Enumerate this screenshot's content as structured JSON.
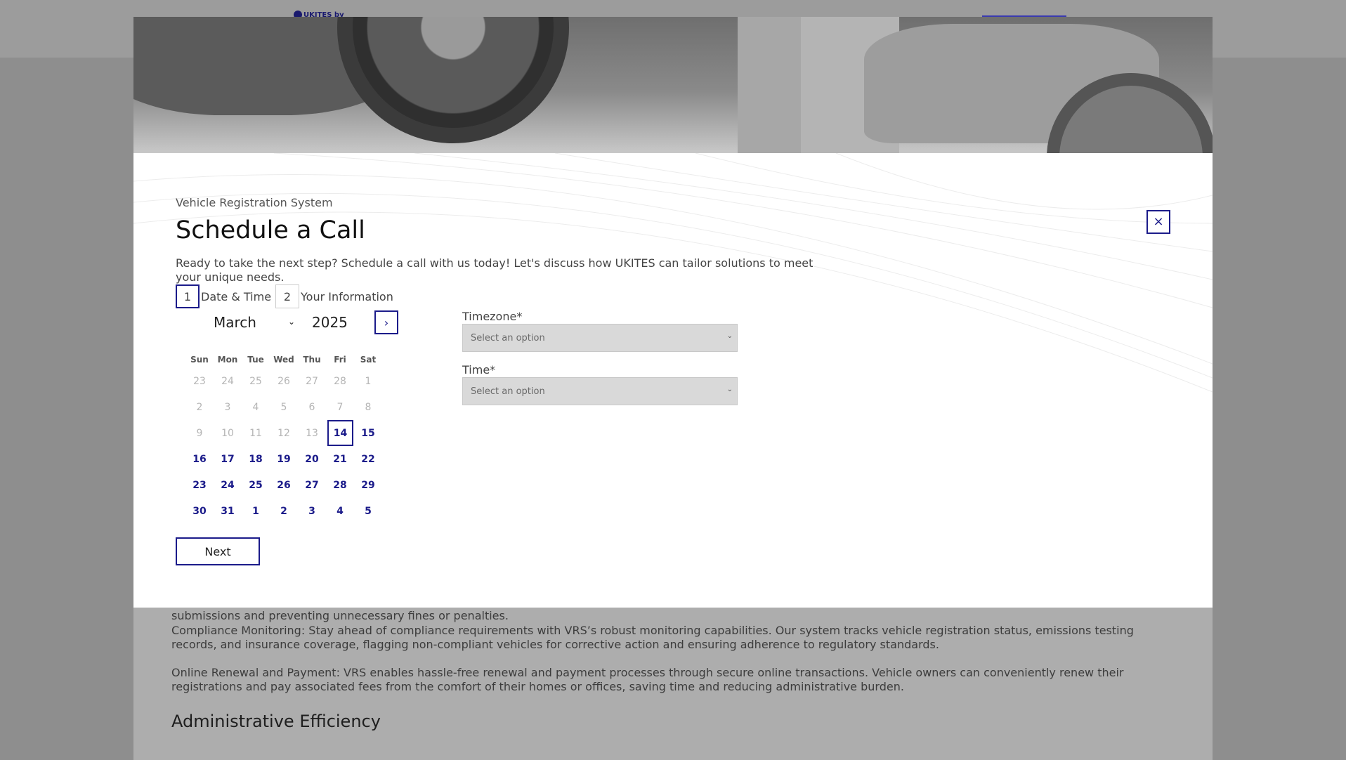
{
  "background": {
    "logo_text": "UKITES by",
    "paragraph1": "submissions and preventing unnecessary fines or penalties.",
    "paragraph2": "Compliance Monitoring: Stay ahead of compliance requirements with VRS’s robust monitoring capabilities. Our system tracks vehicle registration status, emissions testing records, and insurance coverage, flagging non-compliant vehicles for corrective action and ensuring adherence to regulatory standards.",
    "paragraph3": "Online Renewal and Payment: VRS  enables hassle-free renewal and payment processes through secure online transactions. Vehicle owners can conveniently renew their registrations and pay associated fees from the comfort of their homes or offices, saving time and reducing administrative burden.",
    "heading": "Administrative Efficiency"
  },
  "modal": {
    "eyebrow": "Vehicle Registration System",
    "title": "Schedule a Call",
    "description": "Ready to take the next step? Schedule a call with us today! Let's discuss how UKITES can tailor solutions to meet your unique needs.",
    "close_label": "×",
    "steps": [
      {
        "num": "1",
        "label": "Date & Time"
      },
      {
        "num": "2",
        "label": "Your Information"
      }
    ],
    "calendar": {
      "month": "March",
      "year": "2025",
      "next_icon": "›",
      "weekdays": [
        "Sun",
        "Mon",
        "Tue",
        "Wed",
        "Thu",
        "Fri",
        "Sat"
      ],
      "weeks": [
        [
          {
            "d": "23",
            "s": "muted"
          },
          {
            "d": "24",
            "s": "muted"
          },
          {
            "d": "25",
            "s": "muted"
          },
          {
            "d": "26",
            "s": "muted"
          },
          {
            "d": "27",
            "s": "muted"
          },
          {
            "d": "28",
            "s": "muted"
          },
          {
            "d": "1",
            "s": "muted"
          }
        ],
        [
          {
            "d": "2",
            "s": "muted"
          },
          {
            "d": "3",
            "s": "muted"
          },
          {
            "d": "4",
            "s": "muted"
          },
          {
            "d": "5",
            "s": "muted"
          },
          {
            "d": "6",
            "s": "muted"
          },
          {
            "d": "7",
            "s": "muted"
          },
          {
            "d": "8",
            "s": "muted"
          }
        ],
        [
          {
            "d": "9",
            "s": "muted"
          },
          {
            "d": "10",
            "s": "muted"
          },
          {
            "d": "11",
            "s": "muted"
          },
          {
            "d": "12",
            "s": "muted"
          },
          {
            "d": "13",
            "s": "muted"
          },
          {
            "d": "14",
            "s": "selected"
          },
          {
            "d": "15",
            "s": "avail"
          }
        ],
        [
          {
            "d": "16",
            "s": "avail"
          },
          {
            "d": "17",
            "s": "avail"
          },
          {
            "d": "18",
            "s": "avail"
          },
          {
            "d": "19",
            "s": "avail"
          },
          {
            "d": "20",
            "s": "avail"
          },
          {
            "d": "21",
            "s": "avail"
          },
          {
            "d": "22",
            "s": "avail"
          }
        ],
        [
          {
            "d": "23",
            "s": "avail"
          },
          {
            "d": "24",
            "s": "avail"
          },
          {
            "d": "25",
            "s": "avail"
          },
          {
            "d": "26",
            "s": "avail"
          },
          {
            "d": "27",
            "s": "avail"
          },
          {
            "d": "28",
            "s": "avail"
          },
          {
            "d": "29",
            "s": "avail"
          }
        ],
        [
          {
            "d": "30",
            "s": "avail"
          },
          {
            "d": "31",
            "s": "avail"
          },
          {
            "d": "1",
            "s": "avail"
          },
          {
            "d": "2",
            "s": "avail"
          },
          {
            "d": "3",
            "s": "avail"
          },
          {
            "d": "4",
            "s": "avail"
          },
          {
            "d": "5",
            "s": "avail"
          }
        ]
      ]
    },
    "next_button": "Next",
    "timezone": {
      "label": "Timezone*",
      "placeholder": "Select an option"
    },
    "time": {
      "label": "Time*",
      "placeholder": "Select an option"
    }
  },
  "colors": {
    "accent": "#1b1b8a",
    "overlay": "#8e8e8e"
  },
  "icons": {
    "close": "close-icon",
    "next_month": "chevron-right-icon",
    "dropdown": "chevron-down-icon"
  }
}
